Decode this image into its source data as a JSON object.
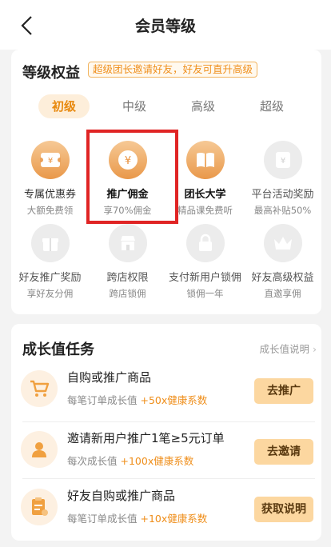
{
  "nav": {
    "title": "会员等级"
  },
  "benefits_card": {
    "title": "等级权益",
    "promo": "超级团长邀请好友，好友可直升高级",
    "tabs": [
      "初级",
      "中级",
      "高级",
      "超级"
    ],
    "items": [
      {
        "label": "专属优惠券",
        "sub": "大额免费领",
        "icon": "coupon-icon",
        "active": true
      },
      {
        "label": "推广佣金",
        "sub": "享70%佣金",
        "icon": "yen-coin-icon",
        "active": true
      },
      {
        "label": "团长大学",
        "sub": "精品课免费听",
        "icon": "book-icon",
        "active": true
      },
      {
        "label": "平台活动奖励",
        "sub": "最高补贴50%",
        "icon": "reward-ticket-icon",
        "active": false
      },
      {
        "label": "好友推广奖励",
        "sub": "享好友分佣",
        "icon": "gift-icon",
        "active": false
      },
      {
        "label": "跨店权限",
        "sub": "跨店锁佣",
        "icon": "store-icon",
        "active": false
      },
      {
        "label": "支付新用户锁佣",
        "sub": "锁佣一年",
        "icon": "lock-icon",
        "active": false
      },
      {
        "label": "好友高级权益",
        "sub": "直邀享佣",
        "icon": "crown-icon",
        "active": false
      }
    ]
  },
  "tasks_card": {
    "title": "成长值任务",
    "help": "成长值说明",
    "tasks": [
      {
        "title": "自购或推广商品",
        "desc_prefix": "每笔订单成长值",
        "desc_plus": "+50x健康系数",
        "button": "去推广",
        "icon": "cart-icon"
      },
      {
        "title": "邀请新用户推广1笔≥5元订单",
        "desc_prefix": "每次成长值",
        "desc_plus": "+100x健康系数",
        "button": "去邀请",
        "icon": "user-icon"
      },
      {
        "title": "好友自购或推广商品",
        "desc_prefix": "每笔订单成长值",
        "desc_plus": "+10x健康系数",
        "button": "获取说明",
        "icon": "clipboard-icon"
      }
    ]
  },
  "colors": {
    "accent": "#e8890e",
    "highlight_box": "#e02424",
    "button_bg": "#fcd7a0"
  }
}
